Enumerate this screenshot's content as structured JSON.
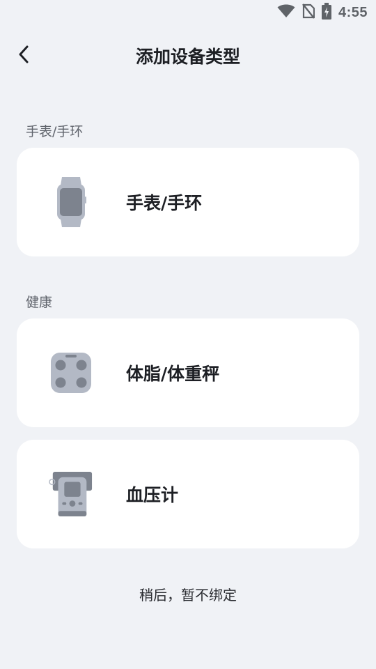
{
  "status_bar": {
    "time": "4:55",
    "icons": [
      "wifi-icon",
      "no-sim-icon",
      "battery-charging-icon"
    ]
  },
  "header": {
    "title": "添加设备类型",
    "back_icon": "chevron-left-icon"
  },
  "sections": [
    {
      "label": "手表/手环",
      "items": [
        {
          "label": "手表/手环",
          "icon": "smartwatch-icon"
        }
      ]
    },
    {
      "label": "健康",
      "items": [
        {
          "label": "体脂/体重秤",
          "icon": "body-scale-icon"
        },
        {
          "label": "血压计",
          "icon": "blood-pressure-monitor-icon"
        }
      ]
    }
  ],
  "footer": {
    "skip_label": "稍后，暂不绑定"
  },
  "colors": {
    "background": "#f0f2f6",
    "card": "#ffffff",
    "icon_gray": "#b3b9c5",
    "icon_dark": "#7d838e"
  }
}
